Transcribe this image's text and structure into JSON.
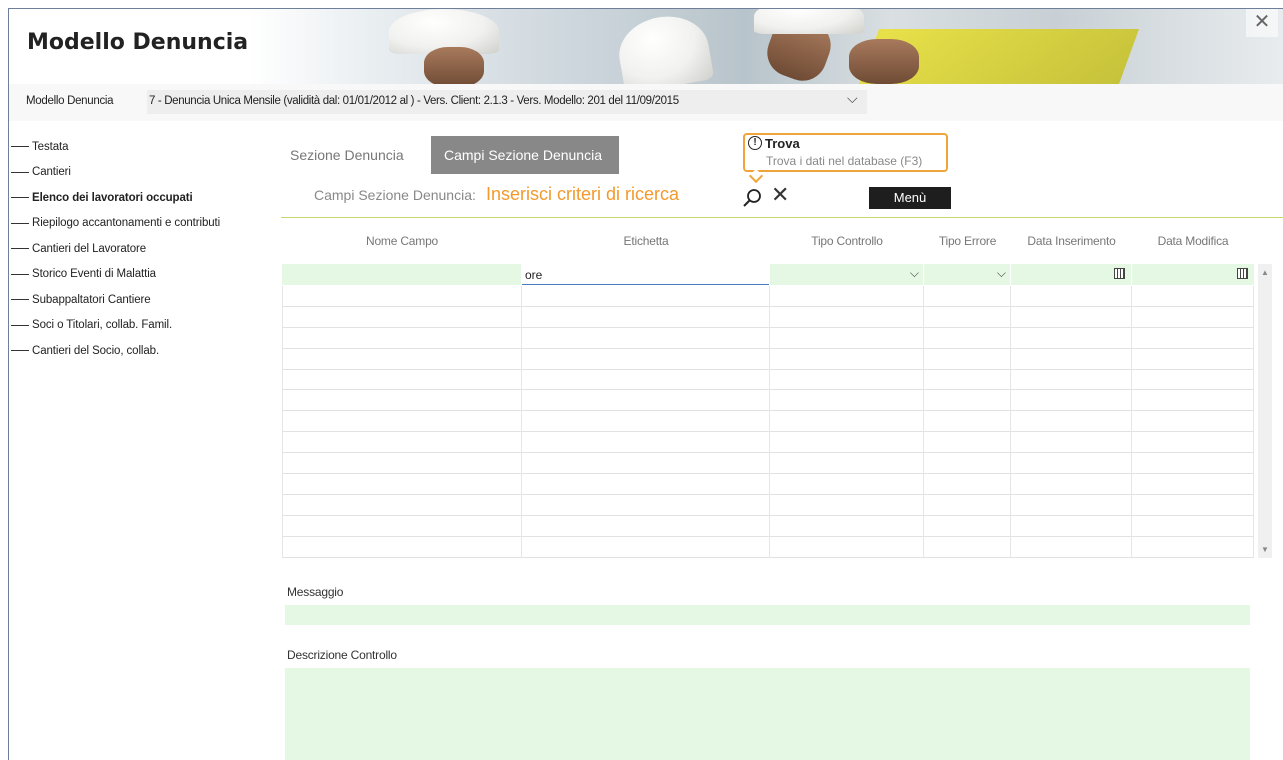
{
  "window": {
    "title": "Modello Denuncia",
    "close_glyph": "✕"
  },
  "model": {
    "label": "Modello Denuncia",
    "selected": "7 - Denuncia Unica Mensile (validità dal: 01/01/2012 al ) - Vers. Client: 2.1.3 - Vers. Modello: 201 del 11/09/2015",
    "chevron": "⌵"
  },
  "sidebar": {
    "items": [
      {
        "label": "Testata",
        "active": false
      },
      {
        "label": "Cantieri",
        "active": false
      },
      {
        "label": "Elenco dei lavoratori occupati",
        "active": true
      },
      {
        "label": "Riepilogo accantonamenti e contributi",
        "active": false
      },
      {
        "label": "Cantieri del Lavoratore",
        "active": false
      },
      {
        "label": "Storico Eventi di Malattia",
        "active": false
      },
      {
        "label": "Subappaltatori Cantiere",
        "active": false
      },
      {
        "label": "Soci o Titolari, collab. Famil.",
        "active": false
      },
      {
        "label": "Cantieri del Socio, collab.",
        "active": false
      }
    ]
  },
  "tabs": [
    {
      "label": "Sezione Denuncia",
      "active": false
    },
    {
      "label": "Campi Sezione Denuncia",
      "active": true
    }
  ],
  "search": {
    "label": "Campi Sezione Denuncia:",
    "hint": "Inserisci criteri di ricerca",
    "clear_glyph": "✕",
    "menu_label": "Menù"
  },
  "tooltip": {
    "icon": "!",
    "title": "Trova",
    "text": "Trova i dati nel database (F3)"
  },
  "grid": {
    "columns": [
      "Nome Campo",
      "Etichetta",
      "Tipo Controllo",
      "Tipo Errore",
      "Data Inserimento",
      "Data Modifica"
    ],
    "filters": {
      "nome_campo": "",
      "etichetta": "ore",
      "tipo_controllo": "",
      "tipo_errore": "",
      "data_inserimento": "",
      "data_modifica": ""
    },
    "chevron": "⌵",
    "scroll_up": "▲",
    "scroll_down": "▼"
  },
  "fields": {
    "messaggio_label": "Messaggio",
    "messaggio_value": "",
    "descrizione_label": "Descrizione Controllo",
    "descrizione_value": ""
  },
  "colors": {
    "accent": "#f29a2e",
    "field_bg": "#e4f8e4",
    "active_tab": "#888888",
    "divider": "#c5d86d"
  }
}
